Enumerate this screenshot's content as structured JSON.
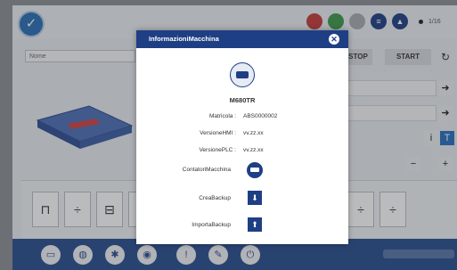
{
  "topbar": {
    "right_text": "1/16"
  },
  "left": {
    "name_field_value": "Nome"
  },
  "right": {
    "stop_label": "STOP",
    "start_label": "START",
    "rows": [
      "",
      "",
      "",
      ""
    ]
  },
  "tools": {
    "items": [
      "⊓",
      "÷",
      "⊟",
      "⊏",
      "÷",
      "÷"
    ]
  },
  "bottombar": {
    "items": [
      "folder",
      "globe",
      "gear",
      "camera",
      "info",
      "tools",
      "power"
    ]
  },
  "dialog": {
    "title": "InformazioniMacchina",
    "model": "M680TR",
    "fields": [
      {
        "label": "Matricola :",
        "value": "ABS0000002"
      },
      {
        "label": "VersioneHMI :",
        "value": "vv.zz.xx"
      },
      {
        "label": "VersionePLC :",
        "value": "vv.zz.xx"
      }
    ],
    "actions": [
      {
        "label": "ContatoriMacchina",
        "icon": "counter-icon"
      },
      {
        "label": "CreaBackup",
        "icon": "download-icon"
      },
      {
        "label": "ImportaBackup",
        "icon": "upload-icon"
      }
    ]
  }
}
